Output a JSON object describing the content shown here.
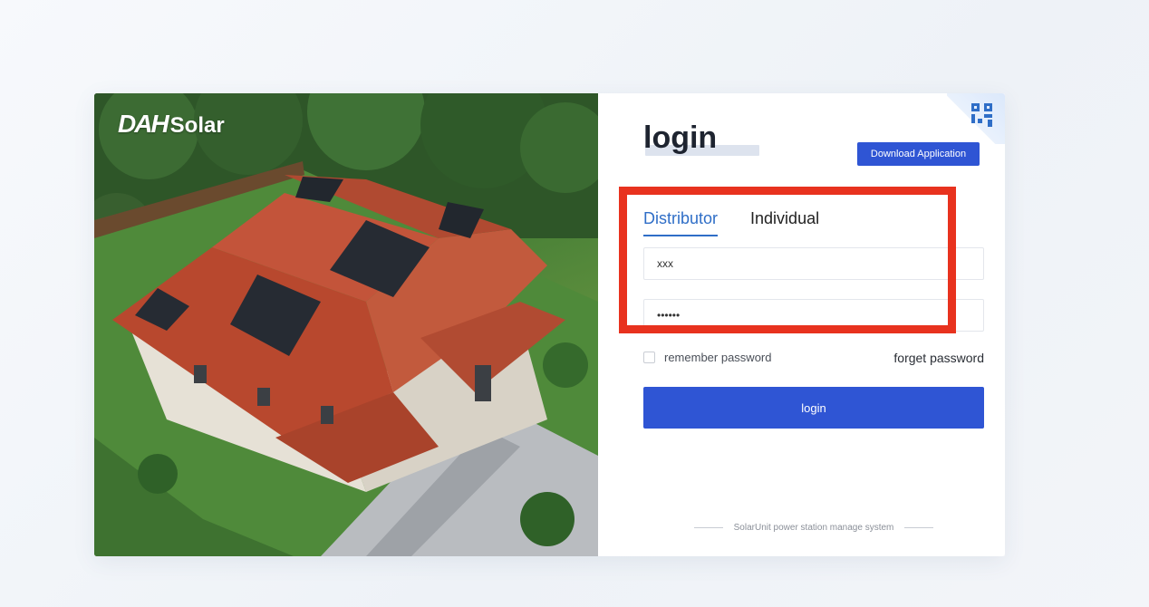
{
  "brand": {
    "logo_mark": "DAH",
    "logo_word": "Solar"
  },
  "header": {
    "title": "login",
    "download_label": "Download Application",
    "qr_icon": "qr-code-icon"
  },
  "tabs": [
    {
      "label": "Distributor",
      "active": true
    },
    {
      "label": "Individual",
      "active": false
    }
  ],
  "form": {
    "username_value": "xxx",
    "password_value": "••••••",
    "remember_label": "remember password",
    "remember_checked": false,
    "forget_label": "forget password",
    "submit_label": "login"
  },
  "footer": {
    "text": "SolarUnit power station manage system"
  },
  "colors": {
    "primary": "#2f55d4",
    "tab_active": "#2f6ec7",
    "highlight": "#e8321e"
  }
}
